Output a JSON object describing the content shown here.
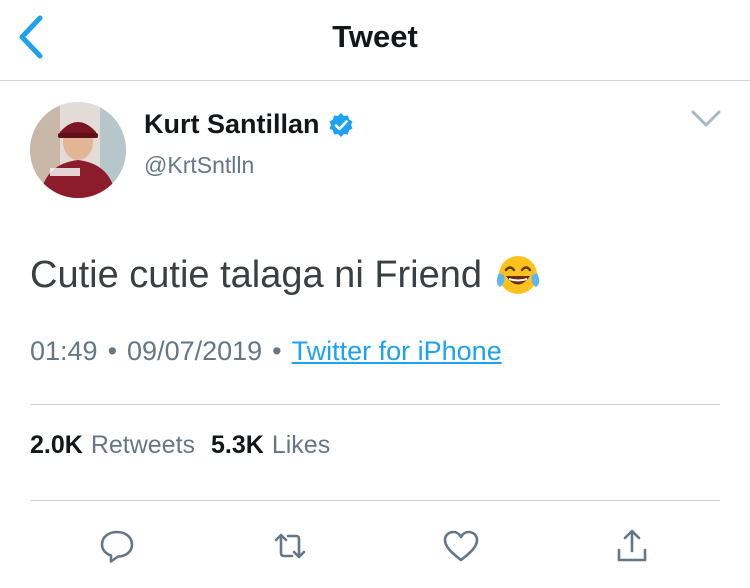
{
  "header": {
    "title": "Tweet",
    "back_icon": "chevron-left-icon"
  },
  "tweet": {
    "author_name": "Kurt Santillan",
    "handle": "@KrtSntlln",
    "verified": true,
    "text": "Cutie cutie talaga ni Friend",
    "emoji": "face-with-tears-of-joy-icon",
    "time": "01:49",
    "date": "09/07/2019",
    "source": "Twitter for iPhone",
    "separator": "•"
  },
  "stats": {
    "retweets_count": "2.0K",
    "retweets_label": "Retweets",
    "likes_count": "5.3K",
    "likes_label": "Likes"
  },
  "actions": [
    "reply-icon",
    "retweet-icon",
    "like-icon",
    "share-icon"
  ],
  "colors": {
    "accent": "#1da1f2",
    "secondary_text": "#657786",
    "divider": "#cfd4d8"
  }
}
